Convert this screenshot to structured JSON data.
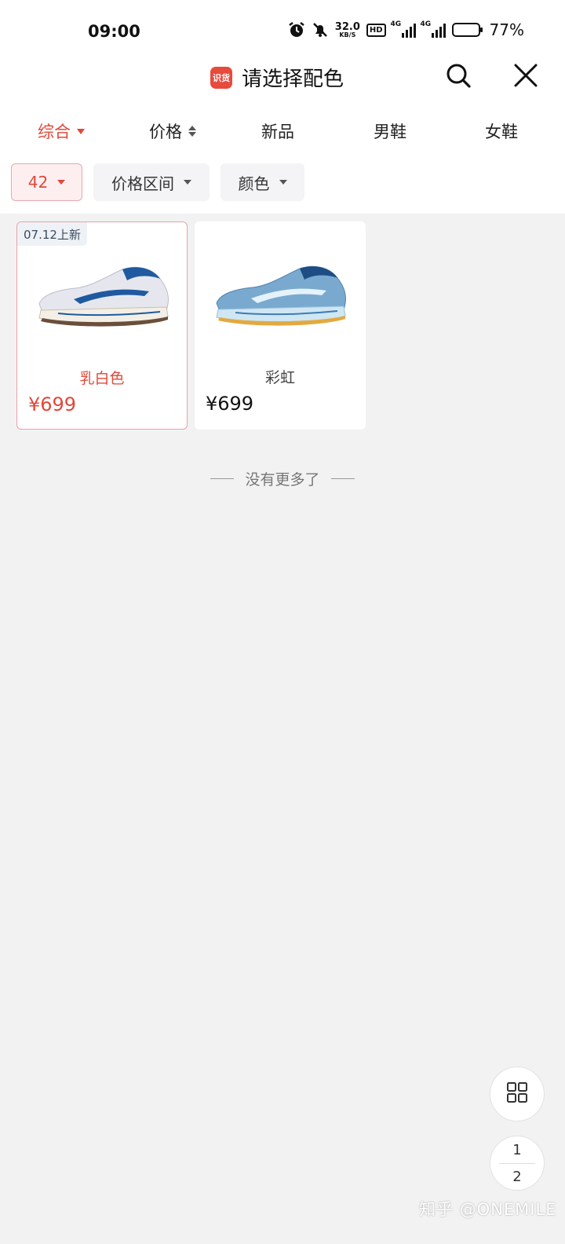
{
  "status_bar": {
    "time": "09:00",
    "net_speed_value": "32.0",
    "net_speed_unit": "KB/S",
    "hd_label": "HD",
    "signal1_label": "4G",
    "signal2_label": "4G",
    "battery_percent": 77,
    "battery_text": "77%"
  },
  "header": {
    "app_badge": "识货",
    "title": "请选择配色",
    "icons": [
      "search-icon",
      "close-icon"
    ]
  },
  "sort_tabs": [
    {
      "label": "综合",
      "active": true
    },
    {
      "label": "价格",
      "active": false
    },
    {
      "label": "新品",
      "active": false
    },
    {
      "label": "男鞋",
      "active": false
    },
    {
      "label": "女鞋",
      "active": false
    }
  ],
  "filters": [
    {
      "label": "42",
      "active": true
    },
    {
      "label": "价格区间",
      "active": false
    },
    {
      "label": "颜色",
      "active": false
    }
  ],
  "products": [
    {
      "tag": "07.12上新",
      "color_name": "乳白色",
      "price": "¥699",
      "selected": true,
      "shoe_colors": {
        "upper": "#e6e7ee",
        "accent": "#1f5aa0",
        "sole": "#f3efe6"
      }
    },
    {
      "tag": "",
      "color_name": "彩虹",
      "price": "¥699",
      "selected": false,
      "shoe_colors": {
        "upper": "#79a9cf",
        "accent": "#1e4c84",
        "sole": "#cfe6f3"
      }
    }
  ],
  "list_end_text": "没有更多了",
  "floating": {
    "grid_icon": "grid-icon",
    "page_current": "1",
    "page_total": "2"
  },
  "watermark": "知乎 @ONEMILE",
  "colors": {
    "accent_red": "#e0483a",
    "page_bg": "#f2f2f3"
  }
}
